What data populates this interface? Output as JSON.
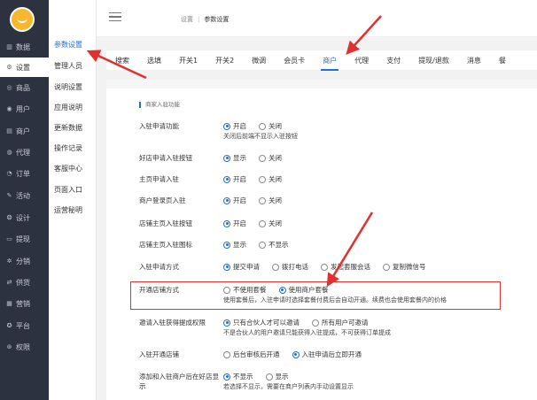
{
  "sidebar": {
    "items": [
      {
        "icon": "chart-icon",
        "glyph": "▥",
        "label": "数据"
      },
      {
        "icon": "gear-icon",
        "glyph": "⚙",
        "label": "设置"
      },
      {
        "icon": "product-icon",
        "glyph": "◎",
        "label": "商品"
      },
      {
        "icon": "user-icon",
        "glyph": "◉",
        "label": "用户"
      },
      {
        "icon": "store-icon",
        "glyph": "▤",
        "label": "商户"
      },
      {
        "icon": "agent-icon",
        "glyph": "◍",
        "label": "代理"
      },
      {
        "icon": "order-icon",
        "glyph": "◔",
        "label": "订单"
      },
      {
        "icon": "activity-icon",
        "glyph": "✎",
        "label": "活动"
      },
      {
        "icon": "design-icon",
        "glyph": "❂",
        "label": "设计"
      },
      {
        "icon": "withdraw-icon",
        "glyph": "▭",
        "label": "提现"
      },
      {
        "icon": "share-icon",
        "glyph": "✲",
        "label": "分销"
      },
      {
        "icon": "supply-icon",
        "glyph": "⇄",
        "label": "供货"
      },
      {
        "icon": "marketing-icon",
        "glyph": "▦",
        "label": "营销"
      },
      {
        "icon": "platform-icon",
        "glyph": "✪",
        "label": "平台"
      },
      {
        "icon": "permission-icon",
        "glyph": "⊛",
        "label": "权限"
      }
    ]
  },
  "submenu": {
    "items": [
      "参数设置",
      "管理人员",
      "说明设置",
      "应用说明",
      "更新数据",
      "操作记录",
      "客服中心",
      "页面入口",
      "运营秘明"
    ]
  },
  "breadcrumb": {
    "parent": "设置",
    "current": "参数设置",
    "sep": "|"
  },
  "tabs": [
    "搜索",
    "选填",
    "开关1",
    "开关2",
    "微调",
    "会员卡",
    "商户",
    "代理",
    "支付",
    "提现/退款",
    "消息",
    "餐"
  ],
  "section_title": "商家入驻功能",
  "rows": [
    {
      "label": "入驻申请功能",
      "options": [
        "开启",
        "关闭"
      ],
      "selected": 0,
      "hint": "关闭后前端不显示入驻按钮"
    },
    {
      "label": "好店申请入驻按钮",
      "options": [
        "显示",
        "关闭"
      ],
      "selected": 0
    },
    {
      "label": "主页申请入驻",
      "options": [
        "开启",
        "关闭"
      ],
      "selected": 0
    },
    {
      "label": "商户登录页入驻",
      "options": [
        "开启",
        "关闭"
      ],
      "selected": 0
    },
    {
      "label": "店铺主页入驻按钮",
      "options": [
        "开启",
        "关闭"
      ],
      "selected": 0
    },
    {
      "label": "店铺主页入驻图标",
      "options": [
        "显示",
        "不显示"
      ],
      "selected": 0
    },
    {
      "label": "入驻申请方式",
      "options": [
        "提交申请",
        "拨打电话",
        "发起套服会话",
        "复制微信号"
      ],
      "selected": 0
    },
    {
      "label": "开通店铺方式",
      "options": [
        "不使用套餐",
        "使用商户套餐"
      ],
      "selected": 1,
      "hint": "使用套餐后，入驻申请时选择套餐付费后会自动开通。续费也会使用套餐内的价格"
    },
    {
      "label": "邀请入驻获得提成权限",
      "options": [
        "只有合伙人才可以邀请",
        "所有用户可邀请"
      ],
      "selected": 0,
      "hint": "不是合伙人的用户邀请只能获得入驻提成，不可获得订单提成"
    },
    {
      "label": "入驻开通店铺",
      "options": [
        "后台审核后开通",
        "入驻申请后立即开通"
      ],
      "selected": 1
    },
    {
      "label": "添加和入驻商户后在好店显示",
      "options": [
        "不显示",
        "显示"
      ],
      "selected": 0,
      "hint": "若选择不显示，需要在商户列表内手动设置显示"
    }
  ]
}
